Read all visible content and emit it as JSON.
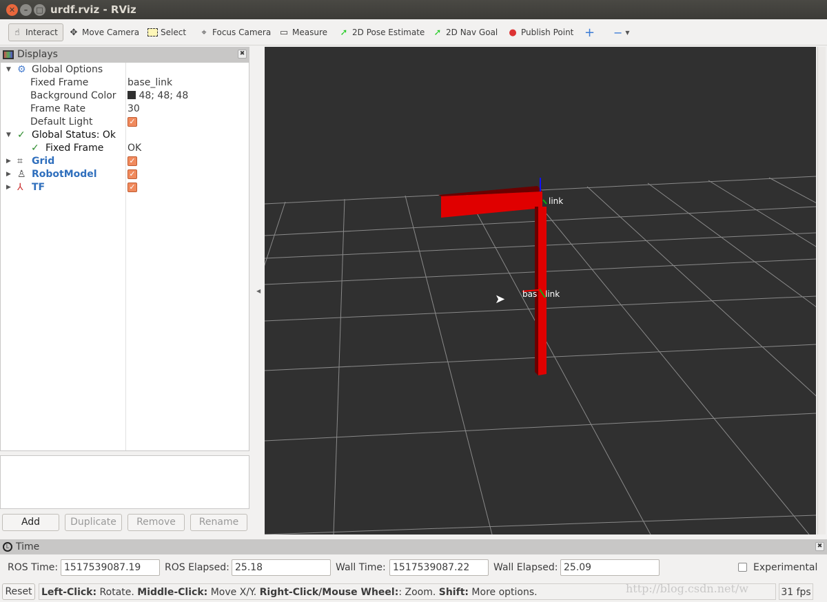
{
  "window": {
    "title": "urdf.rviz - RViz"
  },
  "toolbar": [
    {
      "label": "Interact",
      "icon": "hand-icon",
      "active": true
    },
    {
      "label": "Move Camera",
      "icon": "move-arrows-icon"
    },
    {
      "label": "Select",
      "icon": "select-rect-icon"
    },
    {
      "label": "Focus Camera",
      "icon": "crosshair-icon"
    },
    {
      "label": "Measure",
      "icon": "ruler-icon"
    },
    {
      "label": "2D Pose Estimate",
      "icon": "green-arrow-icon"
    },
    {
      "label": "2D Nav Goal",
      "icon": "green-arrow-icon"
    },
    {
      "label": "Publish Point",
      "icon": "map-pin-icon"
    }
  ],
  "displays": {
    "title": "Displays",
    "global_options": "Global Options",
    "fixed_frame_label": "Fixed Frame",
    "fixed_frame": "base_link",
    "background_label": "Background Color",
    "background": "48; 48; 48",
    "background_color": "#303030",
    "frame_rate_label": "Frame Rate",
    "frame_rate": "30",
    "default_light_label": "Default Light",
    "default_light": true,
    "global_status": "Global Status: Ok",
    "status_fixed_frame": "Fixed Frame",
    "status_value": "OK",
    "items": [
      {
        "label": "Grid",
        "enabled": true
      },
      {
        "label": "RobotModel",
        "enabled": true
      },
      {
        "label": "TF",
        "enabled": true
      }
    ],
    "buttons": {
      "add": "Add",
      "duplicate": "Duplicate",
      "remove": "Remove",
      "rename": "Rename"
    }
  },
  "viewport": {
    "labels": {
      "top": "link",
      "base": "bas",
      "base2": "link"
    },
    "robot_color": "#e00000"
  },
  "time": {
    "title": "Time",
    "ros_time_label": "ROS Time:",
    "ros_time": "1517539087.19",
    "ros_elapsed_label": "ROS Elapsed:",
    "ros_elapsed": "25.18",
    "wall_time_label": "Wall Time:",
    "wall_time": "1517539087.22",
    "wall_elapsed_label": "Wall Elapsed:",
    "wall_elapsed": "25.09",
    "experimental": "Experimental"
  },
  "statusbar": {
    "reset": "Reset",
    "b1": "Left-Click:",
    "t1": " Rotate. ",
    "b2": "Middle-Click:",
    "t2": " Move X/Y. ",
    "b3": "Right-Click/Mouse Wheel:",
    "t3": ": Zoom. ",
    "b4": "Shift:",
    "t4": " More options.",
    "fps": "31 fps",
    "watermark": "http://blog.csdn.net/w"
  }
}
